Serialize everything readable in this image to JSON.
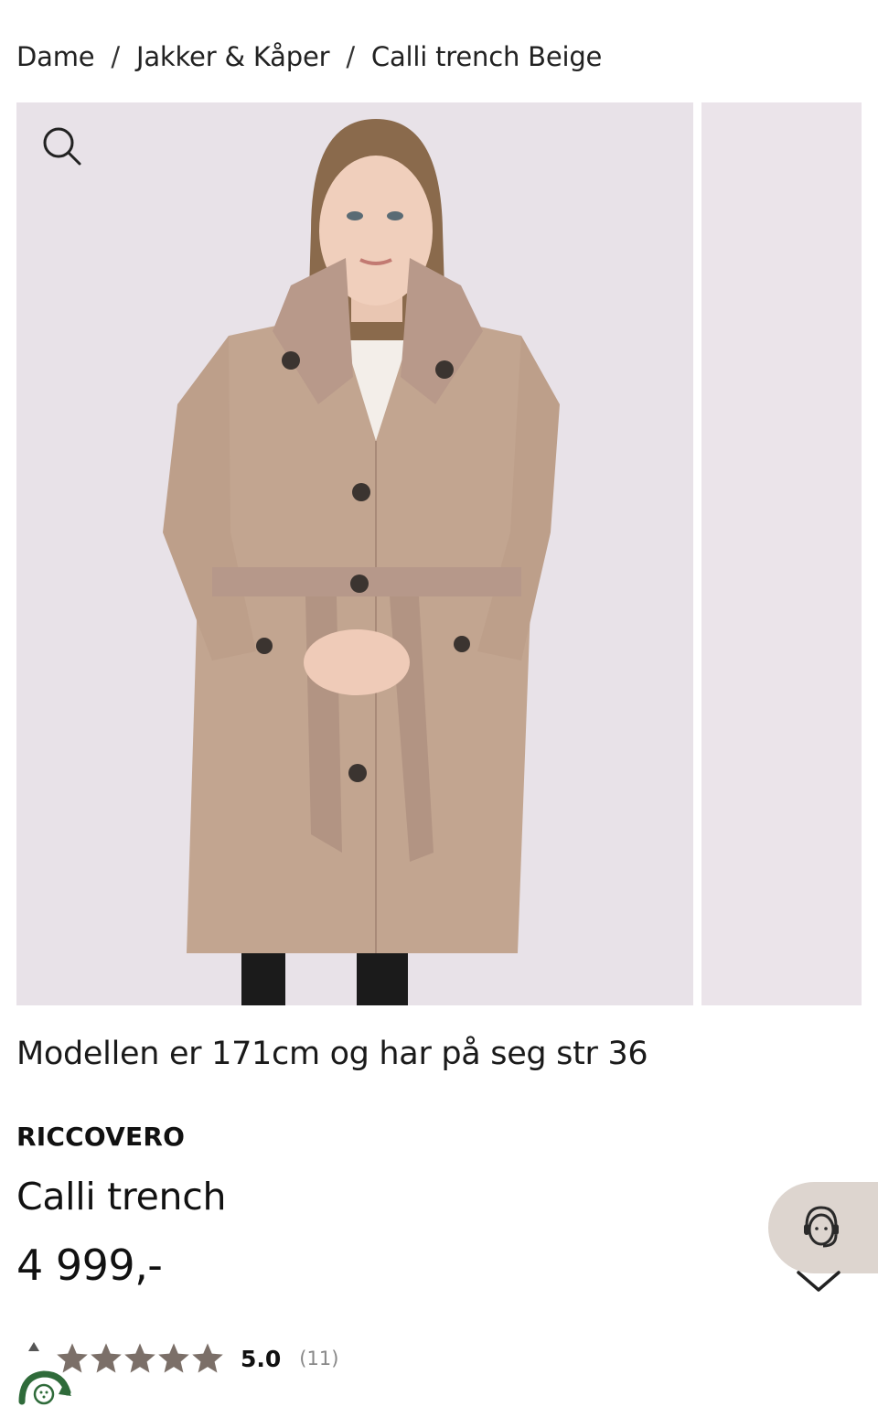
{
  "breadcrumb": {
    "items": [
      {
        "label": "Dame"
      },
      {
        "label": "Jakker & Kåper"
      },
      {
        "label": "Calli trench Beige"
      }
    ],
    "separator": "/"
  },
  "gallery": {
    "zoom_icon": "search-icon",
    "image_description": "Model wearing beige trench coat",
    "slide_count_visible": 2
  },
  "product": {
    "model_note": "Modellen er 171cm og har på seg str 36",
    "brand": "RICCOVERO",
    "name": "Calli trench",
    "price": "4 999,-"
  },
  "rating": {
    "stars": 5,
    "value": "5.0",
    "count": "(11)"
  },
  "chat": {
    "icon": "customer-support-icon"
  },
  "colors": {
    "coat": "#c2a590",
    "background_photo": "#e8e2e8",
    "chat_bg": "#ddd5cf",
    "star": "#7b6f68",
    "eco_green": "#2f6b3a"
  }
}
